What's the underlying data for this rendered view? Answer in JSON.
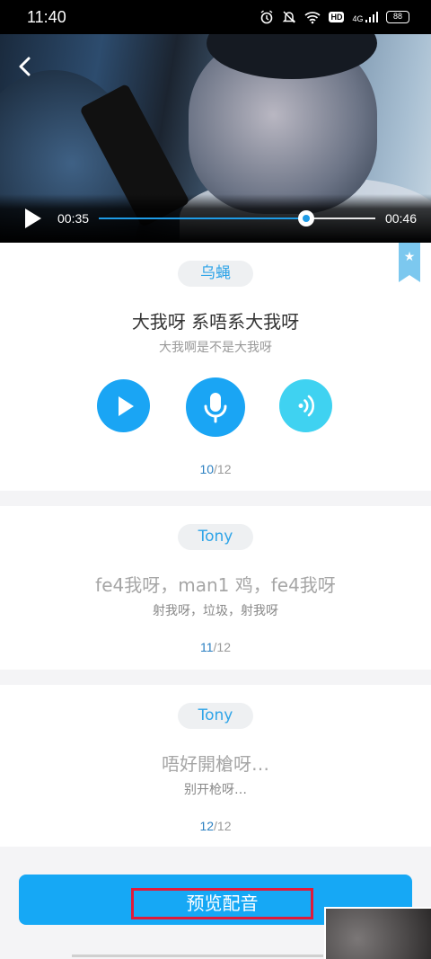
{
  "status_bar": {
    "time": "11:40",
    "net_label": "4G",
    "hd_label": "HD",
    "battery": "88",
    "icons": [
      "alarm-icon",
      "mute-icon",
      "wifi-icon",
      "hd-icon",
      "signal-icon",
      "battery-icon"
    ]
  },
  "video": {
    "current_time": "00:35",
    "duration": "00:46",
    "progress": 0.75,
    "accent": "#1e9be6"
  },
  "lines": [
    {
      "speaker": "乌蝇",
      "text": "大我呀 系唔系大我呀",
      "translation": "大我啊是不是大我呀",
      "index": "10",
      "total": "/12"
    },
    {
      "speaker": "Tony",
      "text": "fe4我呀，man1 鸡，fe4我呀",
      "translation": "射我呀，垃圾，射我呀",
      "index": "11",
      "total": "/12"
    },
    {
      "speaker": "Tony",
      "text": "唔好開槍呀…",
      "translation": "别开枪呀…",
      "index": "12",
      "total": "/12"
    }
  ],
  "actions": {
    "preview_label": "预览配音",
    "button_color": "#16a8f5"
  }
}
